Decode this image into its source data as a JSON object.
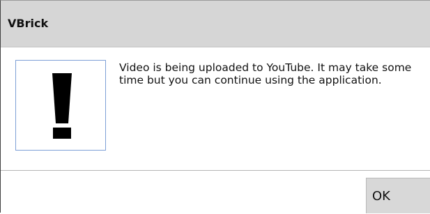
{
  "dialog": {
    "title": "VBrick",
    "icon": "exclamation-icon",
    "message": "Video is being uploaded to YouTube. It may take some time but you can continue using the application.",
    "ok_label": "OK"
  },
  "colors": {
    "title_bar": "#d6d6d6",
    "icon_border": "#7c9fd6",
    "button_bg": "#d8d8d8"
  }
}
